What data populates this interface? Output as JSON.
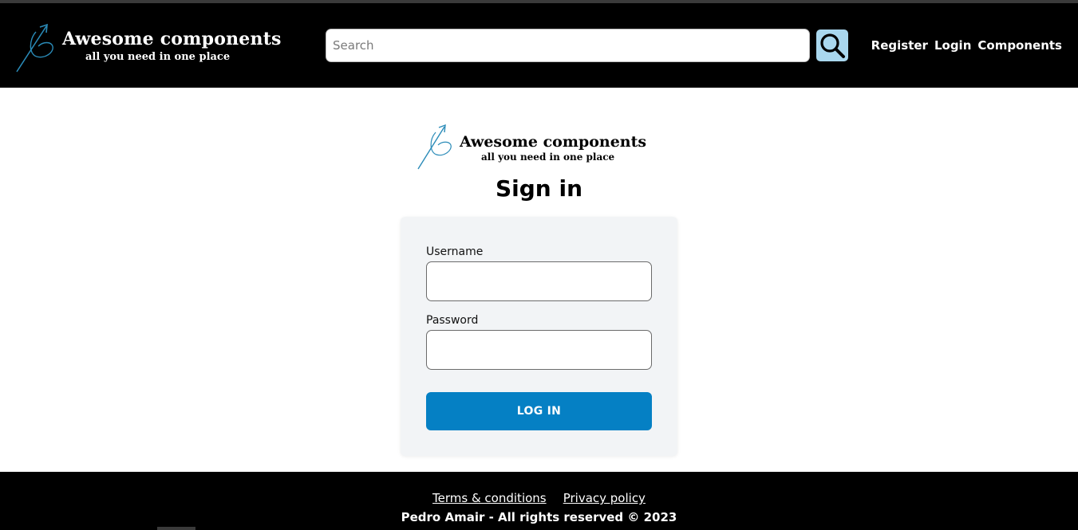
{
  "brand": {
    "title": "Awesome components",
    "tagline": "all you need in one place",
    "icon": "arrow-circle-logo-icon",
    "accent": "#2a8bb8"
  },
  "header": {
    "search": {
      "placeholder": "Search",
      "value": "",
      "button_icon": "search-icon"
    },
    "nav": [
      {
        "label": "Register"
      },
      {
        "label": "Login"
      },
      {
        "label": "Components"
      }
    ]
  },
  "main": {
    "title": "Sign in",
    "form": {
      "username_label": "Username",
      "username_value": "",
      "password_label": "Password",
      "password_value": "",
      "submit_label": "LOG IN"
    }
  },
  "footer": {
    "links": [
      {
        "label": "Terms & conditions"
      },
      {
        "label": "Privacy policy"
      }
    ],
    "copyright": "Pedro Amair - All rights reserved © 2023"
  },
  "colors": {
    "header_bg": "#000000",
    "search_button_bg": "#a9d7ee",
    "card_bg": "#f2f4f6",
    "primary_button": "#0580c4"
  }
}
